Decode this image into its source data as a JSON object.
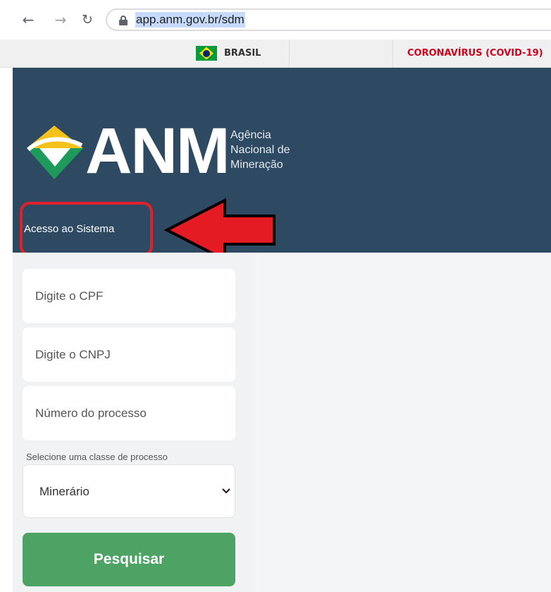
{
  "browser": {
    "url": "app.anm.gov.br/sdm",
    "back_icon": "arrow-left",
    "forward_icon": "arrow-right",
    "reload_icon": "reload",
    "lock_icon": "lock"
  },
  "gov_bar": {
    "country_label": "BRASIL",
    "flag_icon": "brazil-flag",
    "covid_link": "CORONAVÍRUS (COVID-19)",
    "covid_color": "#d0021b"
  },
  "header": {
    "background_color": "#2e4a62",
    "logo_text": "ANM",
    "logo_subtitle_lines": [
      "Agência",
      "Nacional de",
      "Mineração"
    ],
    "section_title": "Acesso ao Sistema"
  },
  "annotation": {
    "highlight_color": "#e2202a",
    "arrow_icon": "red-arrow-left"
  },
  "form": {
    "cpf_placeholder": "Digite o CPF",
    "cnpj_placeholder": "Digite o CNPJ",
    "process_placeholder": "Número do processo",
    "class_label": "Selecione uma classe de processo",
    "class_selected": "Minerário",
    "search_button": "Pesquisar",
    "search_button_color": "#4ca363"
  }
}
